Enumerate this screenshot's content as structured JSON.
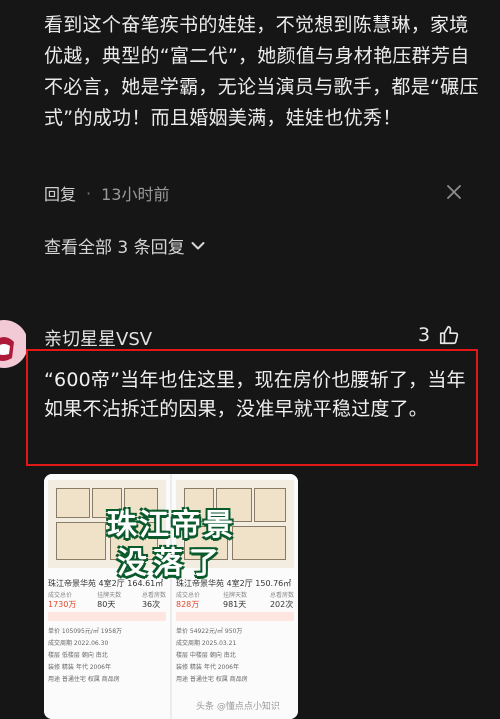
{
  "reply": {
    "text": "看到这个奋笔疾书的娃娃，不觉想到陈慧琳，家境优越，典型的“富二代”，她颜值与身材艳压群芳自不必言，她是学霸，无论当演员与歌手，都是“碾压式”的成功！而且婚姻美满，娃娃也优秀！",
    "reply_label": "回复",
    "time": "13小时前",
    "view_all": "查看全部 3 条回复"
  },
  "comment": {
    "username": "亲切星星VSV",
    "likes": "3",
    "text": "“600帝”当年也住这里，现在房价也腰斩了，当年如果不沾拆迁的因果，没准早就平稳过度了。"
  },
  "thumbnail": {
    "overlay_title": "珠江帝景",
    "overlay_sub": "没落了",
    "watermark": "头条 @懂点点小知识",
    "left": {
      "title": "珠江帝景华苑 4室2厅 164.61㎡",
      "stats": [
        {
          "label": "成交总价",
          "value": "1730万"
        },
        {
          "label": "挂牌天数",
          "value": "80天"
        },
        {
          "label": "总看房数",
          "value": "36次"
        }
      ],
      "rows": [
        "单价 105095元/㎡ 1958万",
        "成交周期 2022.06.30",
        "楼层 低楼层 朝向 南北",
        "装修 精装 年代 2006年",
        "用途 普通住宅 权属 商品房"
      ]
    },
    "right": {
      "title": "珠江帝景华苑 4室2厅 150.76㎡",
      "stats": [
        {
          "label": "成交总价",
          "value": "828万"
        },
        {
          "label": "挂牌天数",
          "value": "981天"
        },
        {
          "label": "总看房数",
          "value": "202次"
        }
      ],
      "rows": [
        "单价 54922元/㎡ 950万",
        "成交周期 2025.03.21",
        "楼层 中楼层 朝向 南北",
        "装修 精装 年代 2006年",
        "用途 普通住宅 权属 商品房"
      ]
    }
  },
  "colors": {
    "background": "#161616",
    "highlight_border": "#e01818",
    "accent_green": "#0b5a2c"
  }
}
